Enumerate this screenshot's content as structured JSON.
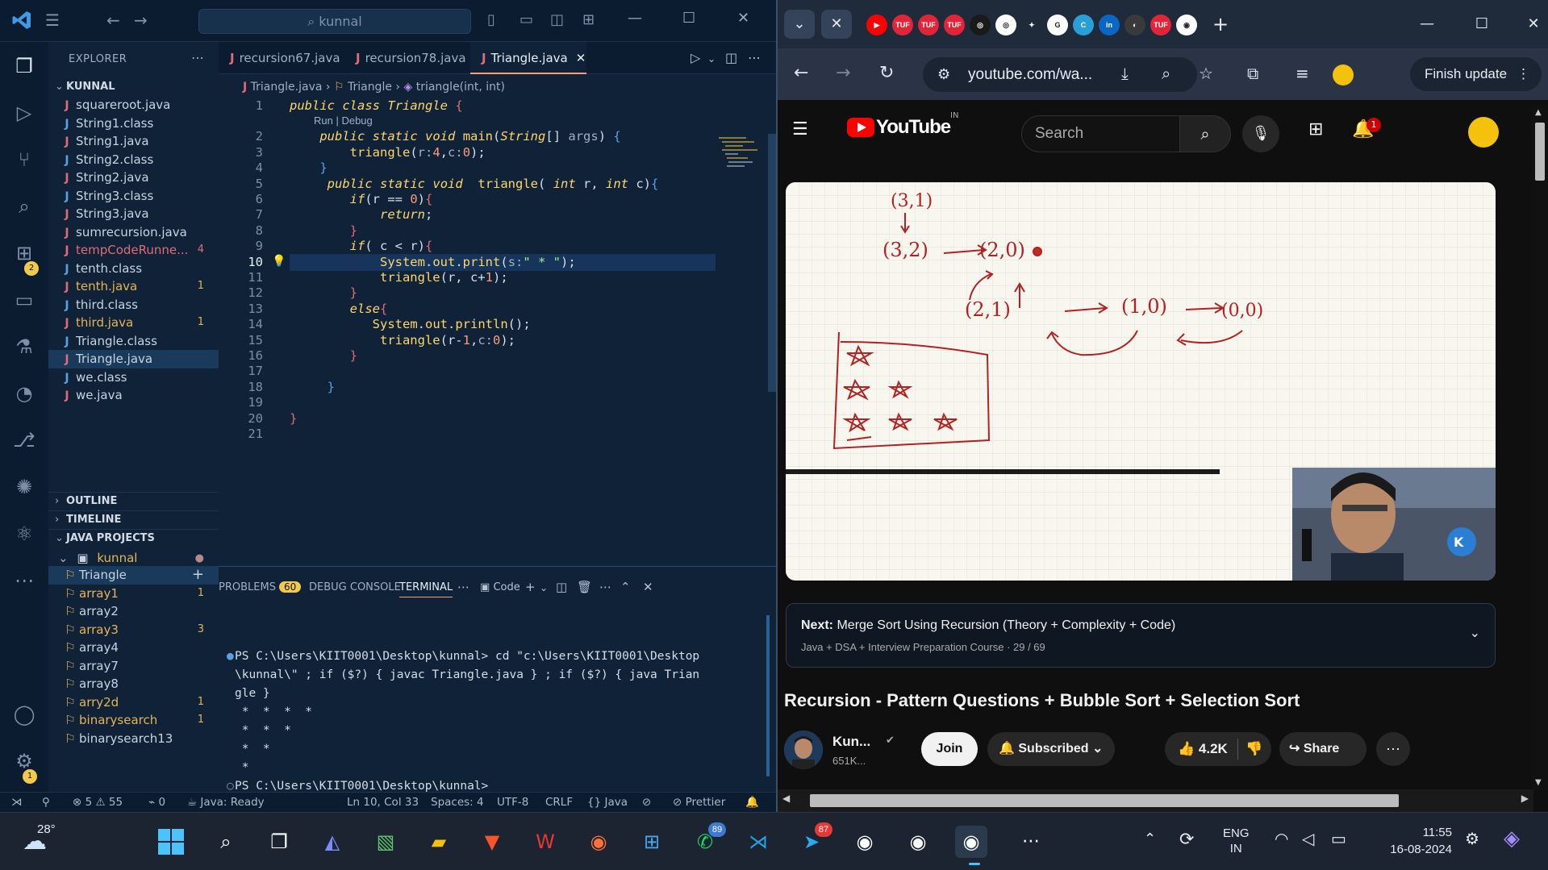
{
  "vscode": {
    "search_text": "kunnal",
    "explorer_title": "EXPLORER",
    "root_folder": "KUNNAL",
    "files": [
      {
        "name": "squareroot.java",
        "icon": "J",
        "state": "normal",
        "badge": ""
      },
      {
        "name": "String1.class",
        "icon": "J",
        "state": "normal",
        "badge": ""
      },
      {
        "name": "String1.java",
        "icon": "J",
        "state": "normal",
        "badge": ""
      },
      {
        "name": "String2.class",
        "icon": "J",
        "state": "normal",
        "badge": ""
      },
      {
        "name": "String2.java",
        "icon": "J",
        "state": "normal",
        "badge": ""
      },
      {
        "name": "String3.class",
        "icon": "J",
        "state": "normal",
        "badge": ""
      },
      {
        "name": "String3.java",
        "icon": "J",
        "state": "normal",
        "badge": ""
      },
      {
        "name": "sumrecursion.java",
        "icon": "J",
        "state": "normal",
        "badge": ""
      },
      {
        "name": "tempCodeRunne...",
        "icon": "J",
        "state": "err",
        "badge": "4"
      },
      {
        "name": "tenth.class",
        "icon": "J",
        "state": "normal",
        "badge": ""
      },
      {
        "name": "tenth.java",
        "icon": "J",
        "state": "warn",
        "badge": "1"
      },
      {
        "name": "third.class",
        "icon": "J",
        "state": "normal",
        "badge": ""
      },
      {
        "name": "third.java",
        "icon": "J",
        "state": "warn",
        "badge": "1"
      },
      {
        "name": "Triangle.class",
        "icon": "J",
        "state": "normal",
        "badge": ""
      },
      {
        "name": "Triangle.java",
        "icon": "J",
        "state": "selected",
        "badge": ""
      },
      {
        "name": "we.class",
        "icon": "J",
        "state": "normal",
        "badge": ""
      },
      {
        "name": "we.java",
        "icon": "J",
        "state": "normal",
        "badge": ""
      }
    ],
    "outline_label": "OUTLINE",
    "timeline_label": "TIMELINE",
    "java_projects_label": "JAVA PROJECTS",
    "project_name": "kunnal",
    "project_items": [
      {
        "name": "Triangle",
        "badge": "+",
        "state": "selected"
      },
      {
        "name": "array1",
        "badge": "1",
        "state": "warn"
      },
      {
        "name": "array2",
        "badge": "",
        "state": "normal"
      },
      {
        "name": "array3",
        "badge": "3",
        "state": "warn"
      },
      {
        "name": "array4",
        "badge": "",
        "state": "normal"
      },
      {
        "name": "array7",
        "badge": "",
        "state": "normal"
      },
      {
        "name": "array8",
        "badge": "",
        "state": "normal"
      },
      {
        "name": "arry2d",
        "badge": "1",
        "state": "warn"
      },
      {
        "name": "binarysearch",
        "badge": "1",
        "state": "warn"
      },
      {
        "name": "binarysearch13",
        "badge": "",
        "state": "normal"
      }
    ],
    "tabs": [
      {
        "label": "recursion67.java"
      },
      {
        "label": "recursion78.java"
      },
      {
        "label": "Triangle.java"
      }
    ],
    "breadcrumb": {
      "file": "Triangle.java",
      "cls": "Triangle",
      "method": "triangle(int, int)"
    },
    "code_lens": "Run | Debug",
    "line_numbers": [
      "1",
      "2",
      "3",
      "4",
      "5",
      "6",
      "7",
      "8",
      "9",
      "10",
      "11",
      "12",
      "13",
      "14",
      "15",
      "16",
      "17",
      "18",
      "19",
      "20",
      "21"
    ],
    "panel": {
      "problems_label": "PROBLEMS",
      "problems_count": "60",
      "debug_label": "DEBUG CONSOLE",
      "terminal_label": "TERMINAL",
      "code_label": "Code",
      "terminal_lines": [
        "PS C:\\Users\\KIIT0001\\Desktop\\kunnal> cd \"c:\\Users\\KIIT0001\\Desktop",
        "\\kunnal\\\" ; if ($?) { javac Triangle.java } ; if ($?) { java Trian",
        "gle }",
        " *  *  *  *",
        " *  *  *",
        " *  *",
        " *",
        "PS C:\\Users\\KIIT0001\\Desktop\\kunnal>"
      ]
    },
    "status": {
      "errors": "5",
      "warnings": "55",
      "ports": "0",
      "java": "Java: Ready",
      "position": "Ln 10, Col 33",
      "spaces": "Spaces: 4",
      "encoding": "UTF-8",
      "eol": "CRLF",
      "language": "Java",
      "prettier": "Prettier"
    },
    "activity_badges": {
      "extensions": "2",
      "manage": "1"
    }
  },
  "chrome": {
    "url": "youtube.com/wa...",
    "finish_update": "Finish update",
    "tab_favicons": [
      {
        "name": "youtube",
        "color": "#ff0000",
        "label": "▶"
      },
      {
        "name": "tuf",
        "color": "#e0253a",
        "label": "TUF"
      },
      {
        "name": "tuf",
        "color": "#e0253a",
        "label": "TUF"
      },
      {
        "name": "tuf",
        "color": "#e0253a",
        "label": "TUF"
      },
      {
        "name": "chatgpt",
        "color": "#1a1a1a",
        "label": "◎"
      },
      {
        "name": "chatgpt",
        "color": "#ffffff",
        "label": "◎"
      },
      {
        "name": "gemini",
        "color": "#1f2a3a",
        "label": "✦"
      },
      {
        "name": "google",
        "color": "#ffffff",
        "label": "G"
      },
      {
        "name": "canva",
        "color": "#2a9fd6",
        "label": "C"
      },
      {
        "name": "linkedin",
        "color": "#0a66c2",
        "label": "in"
      },
      {
        "name": "other",
        "color": "#3a3a3a",
        "label": "◐"
      },
      {
        "name": "tuf",
        "color": "#e0253a",
        "label": "TUF"
      },
      {
        "name": "chrome",
        "color": "#ffffff",
        "label": "◉"
      }
    ]
  },
  "youtube": {
    "search_placeholder": "Search",
    "country": "IN",
    "notifications": "1",
    "next_label": "Next:",
    "next_title": "Merge Sort Using Recursion (Theory + Complexity + Code)",
    "next_sub": "Java + DSA + Interview Preparation Course · 29 / 69",
    "video_title": "Recursion - Pattern Questions + Bubble Sort + Selection Sort",
    "channel_name": "Kun...",
    "subscribers": "651K...",
    "join": "Join",
    "subscribed": "Subscribed",
    "likes": "4.2K",
    "share": "Share",
    "whiteboard_labels": [
      "(3,1)",
      "(3,2)",
      "(2,0)",
      "(2,1)",
      "(1,0)",
      "(0,0)"
    ]
  },
  "taskbar": {
    "weather": "28°",
    "lang_top": "ENG",
    "lang_bottom": "IN",
    "time": "11:55",
    "date": "16-08-2024",
    "whatsapp_badge": "89",
    "telegram_badge": "87"
  }
}
